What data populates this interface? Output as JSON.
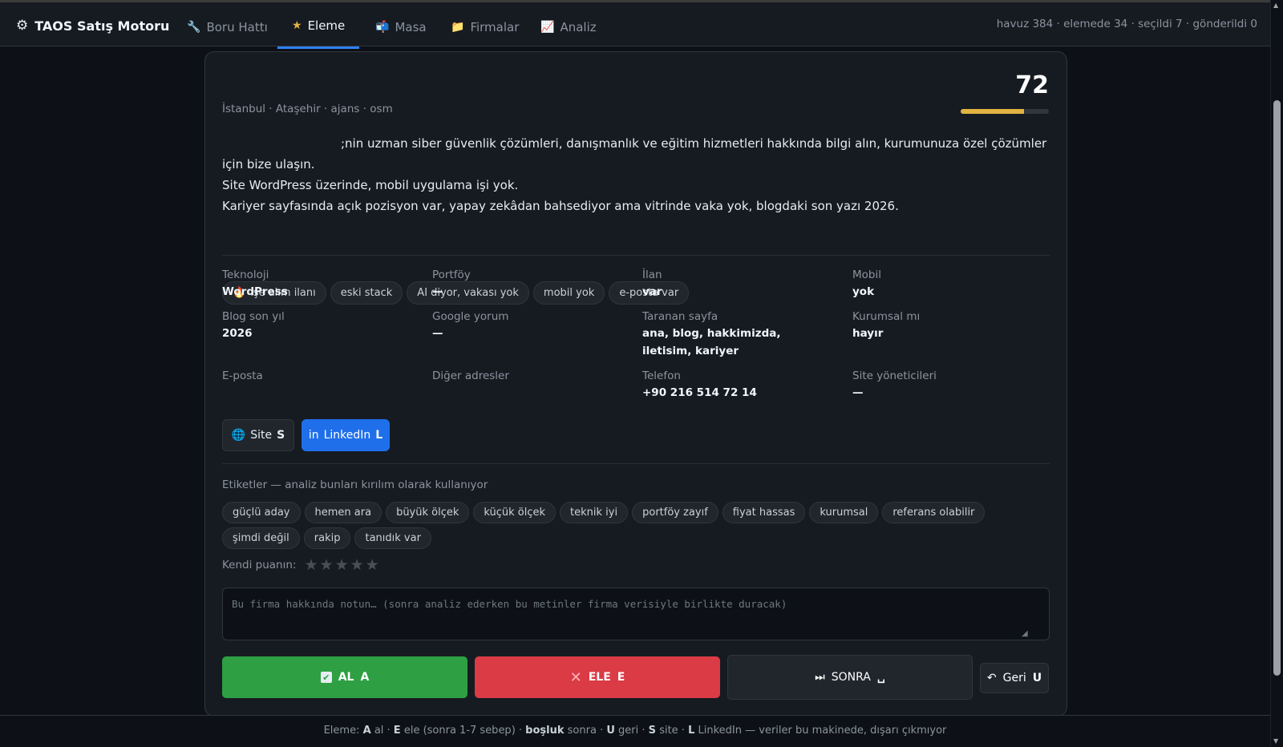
{
  "app": {
    "title": "TAOS Satış Motoru",
    "icon": "gear-icon"
  },
  "nav": {
    "tabs": [
      {
        "label": "Boru Hattı",
        "icon": "wrench-icon"
      },
      {
        "label": "Eleme",
        "icon": "star-icon",
        "active": true
      },
      {
        "label": "Masa",
        "icon": "mailbox-icon"
      },
      {
        "label": "Firmalar",
        "icon": "folder-icon"
      },
      {
        "label": "Analiz",
        "icon": "chart-icon"
      }
    ]
  },
  "stats": "havuz 384 · elemede 34 · seçildi 7 · gönderildi 0",
  "company": {
    "meta": "İstanbul · Ataşehir · ajans · osm",
    "score": "72",
    "score_fraction": 0.72,
    "description": [
      ";nin uzman siber güvenlik çözümleri, danışmanlık ve eğitim hizmetleri hakkında bilgi alın, kurumunuza özel çözümler için bize ulaşın.",
      "Site WordPress üzerinde, mobil uygulama işi yok.",
      "Kariyer sayfasında açık pozisyon var, yapay zekâdan bahsediyor ama vitrinde vaka yok, blogdaki son yazı 2026."
    ],
    "chips": [
      "işe alım ilanı",
      "eski stack",
      "AI diyor, vakası yok",
      "mobil yok",
      "e-posta var"
    ],
    "fields": [
      {
        "label": "Teknoloji",
        "value": "WordPress"
      },
      {
        "label": "Portföy",
        "value": "—"
      },
      {
        "label": "İlan",
        "value": "var"
      },
      {
        "label": "Mobil",
        "value": "yok"
      },
      {
        "label": "Blog son yıl",
        "value": "2026"
      },
      {
        "label": "Google yorum",
        "value": "—"
      },
      {
        "label": "Taranan sayfa",
        "value": "ana, blog, hakkimizda, iletisim, kariyer"
      },
      {
        "label": "Kurumsal mı",
        "value": "hayır"
      },
      {
        "label": "E-posta",
        "value": ""
      },
      {
        "label": "Diğer adresler",
        "value": ""
      },
      {
        "label": "Telefon",
        "value": "+90 216 514 72 14"
      },
      {
        "label": "Site yöneticileri",
        "value": "—"
      }
    ]
  },
  "links": {
    "site_label": "Site",
    "site_key": "S",
    "linkedin_prefix": "in",
    "linkedin_label": "LinkedIn",
    "linkedin_key": "L"
  },
  "tags": {
    "title": "Etiketler — analiz bunları kırılım olarak kullanıyor",
    "items": [
      "güçlü aday",
      "hemen ara",
      "büyük ölçek",
      "küçük ölçek",
      "teknik iyi",
      "portföy zayıf",
      "fiyat hassas",
      "kurumsal",
      "referans olabilir",
      "şimdi değil",
      "rakip",
      "tanıdık var"
    ]
  },
  "rating": {
    "label": "Kendi puanın:",
    "value": 0,
    "max": 5
  },
  "notes": {
    "placeholder": "Bu firma hakkında notun… (sonra analiz ederken bu metinler firma verisiyle birlikte duracak)"
  },
  "actions": {
    "al_label": "AL",
    "al_key": "A",
    "ele_label": "ELE",
    "ele_key": "E",
    "sonra_label": "SONRA",
    "sonra_key": "␣",
    "geri_label": "Geri",
    "geri_key": "U"
  },
  "footer": {
    "p1": "Eleme:",
    "k1": "A",
    "t1": "al ·",
    "k2": "E",
    "t2": "ele (sonra 1-7 sebep) ·",
    "k3": "boşluk",
    "t3": "sonra ·",
    "k4": "U",
    "t4": "geri ·",
    "k5": "S",
    "t5": "site ·",
    "k6": "L",
    "t6": "LinkedIn — veriler bu makinede, dışarı çıkmıyor"
  }
}
